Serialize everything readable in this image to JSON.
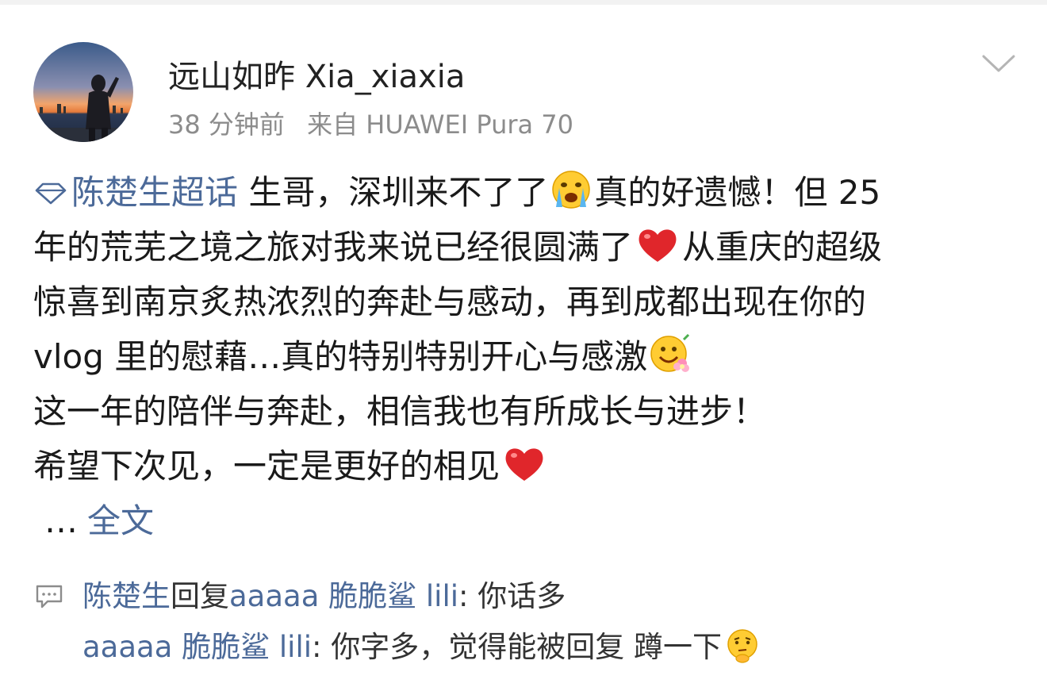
{
  "post": {
    "username": "远山如昨 Xia_xiaxia",
    "time": "38 分钟前",
    "source": "来自 HUAWEI Pura 70",
    "topic": "陈楚生超话",
    "lines": [
      " 生哥，深圳来不了了",
      "真的好遗憾！但 25",
      "年的荒芜之境之旅对我来说已经很圆满了",
      "从重庆的超级",
      "惊喜到南京炙热浓烈的奔赴与感动，再到成都出现在你的",
      "vlog 里的慰藉…真的特别特别开心与感激",
      "这一年的陪伴与奔赴，相信我也有所成长与进步！",
      "希望下次见，一定是更好的相见"
    ],
    "ellipsis": "…",
    "more_link": "全文"
  },
  "comments": [
    {
      "author": "陈楚生",
      "reply_word": "回复",
      "target": "aaaaa 脆脆鲨 lili",
      "text": ": 你话多"
    },
    {
      "author": "aaaaa 脆脆鲨 lili",
      "text": ": 你字多，觉得能被回复 蹲一下"
    }
  ],
  "colors": {
    "link": "#4c6a99",
    "meta": "#8c8c8c",
    "heart": "#e0262b"
  },
  "icons": [
    "chevron-down-icon",
    "super-topic-icon",
    "crying-emoji",
    "red-heart-icon",
    "flower-smile-emoji",
    "comment-icon",
    "thinking-emoji"
  ]
}
